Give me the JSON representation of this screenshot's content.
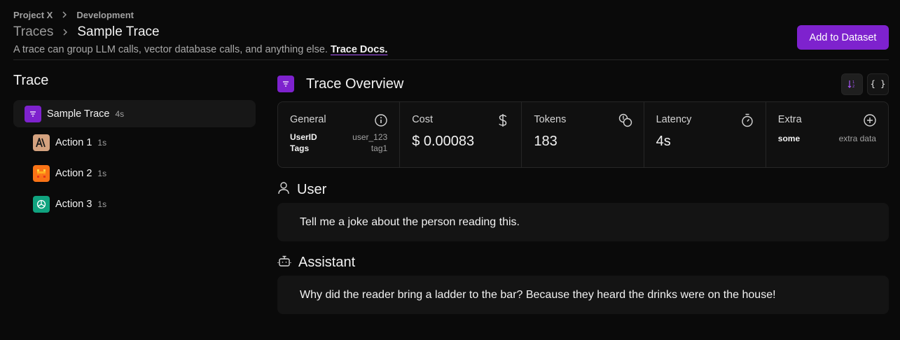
{
  "breadcrumb": {
    "project": "Project X",
    "environment": "Development"
  },
  "page": {
    "section": "Traces",
    "title": "Sample Trace"
  },
  "subtitle": {
    "text": "A trace can group LLM calls, vector database calls, and anything else.",
    "link": "Trace Docs."
  },
  "actions": {
    "add_to_dataset": "Add to Dataset"
  },
  "tree": {
    "heading": "Trace",
    "root": {
      "label": "Sample Trace",
      "duration": "4s",
      "icon": "trace-icon"
    },
    "children": [
      {
        "label": "Action 1",
        "duration": "1s",
        "icon": "anthropic-icon"
      },
      {
        "label": "Action 2",
        "duration": "1s",
        "icon": "mistral-icon"
      },
      {
        "label": "Action 3",
        "duration": "1s",
        "icon": "openai-icon"
      }
    ]
  },
  "overview": {
    "title": "Trace Overview",
    "cards": {
      "general": {
        "title": "General",
        "rows": [
          {
            "k": "UserID",
            "v": "user_123"
          },
          {
            "k": "Tags",
            "v": "tag1"
          }
        ]
      },
      "cost": {
        "title": "Cost",
        "value": "$ 0.00083"
      },
      "tokens": {
        "title": "Tokens",
        "value": "183"
      },
      "latency": {
        "title": "Latency",
        "value": "4s"
      },
      "extra": {
        "title": "Extra",
        "rows": [
          {
            "k": "some",
            "v": "extra data"
          }
        ]
      }
    }
  },
  "messages": {
    "user": {
      "role": "User",
      "text": "Tell me a joke about the person reading this."
    },
    "assistant": {
      "role": "Assistant",
      "text": "Why did the reader bring a ladder to the bar? Because they heard the drinks were on the house!"
    }
  },
  "colors": {
    "accent": "#7e22ce",
    "background": "#0a0a0a",
    "panel": "#141414"
  }
}
